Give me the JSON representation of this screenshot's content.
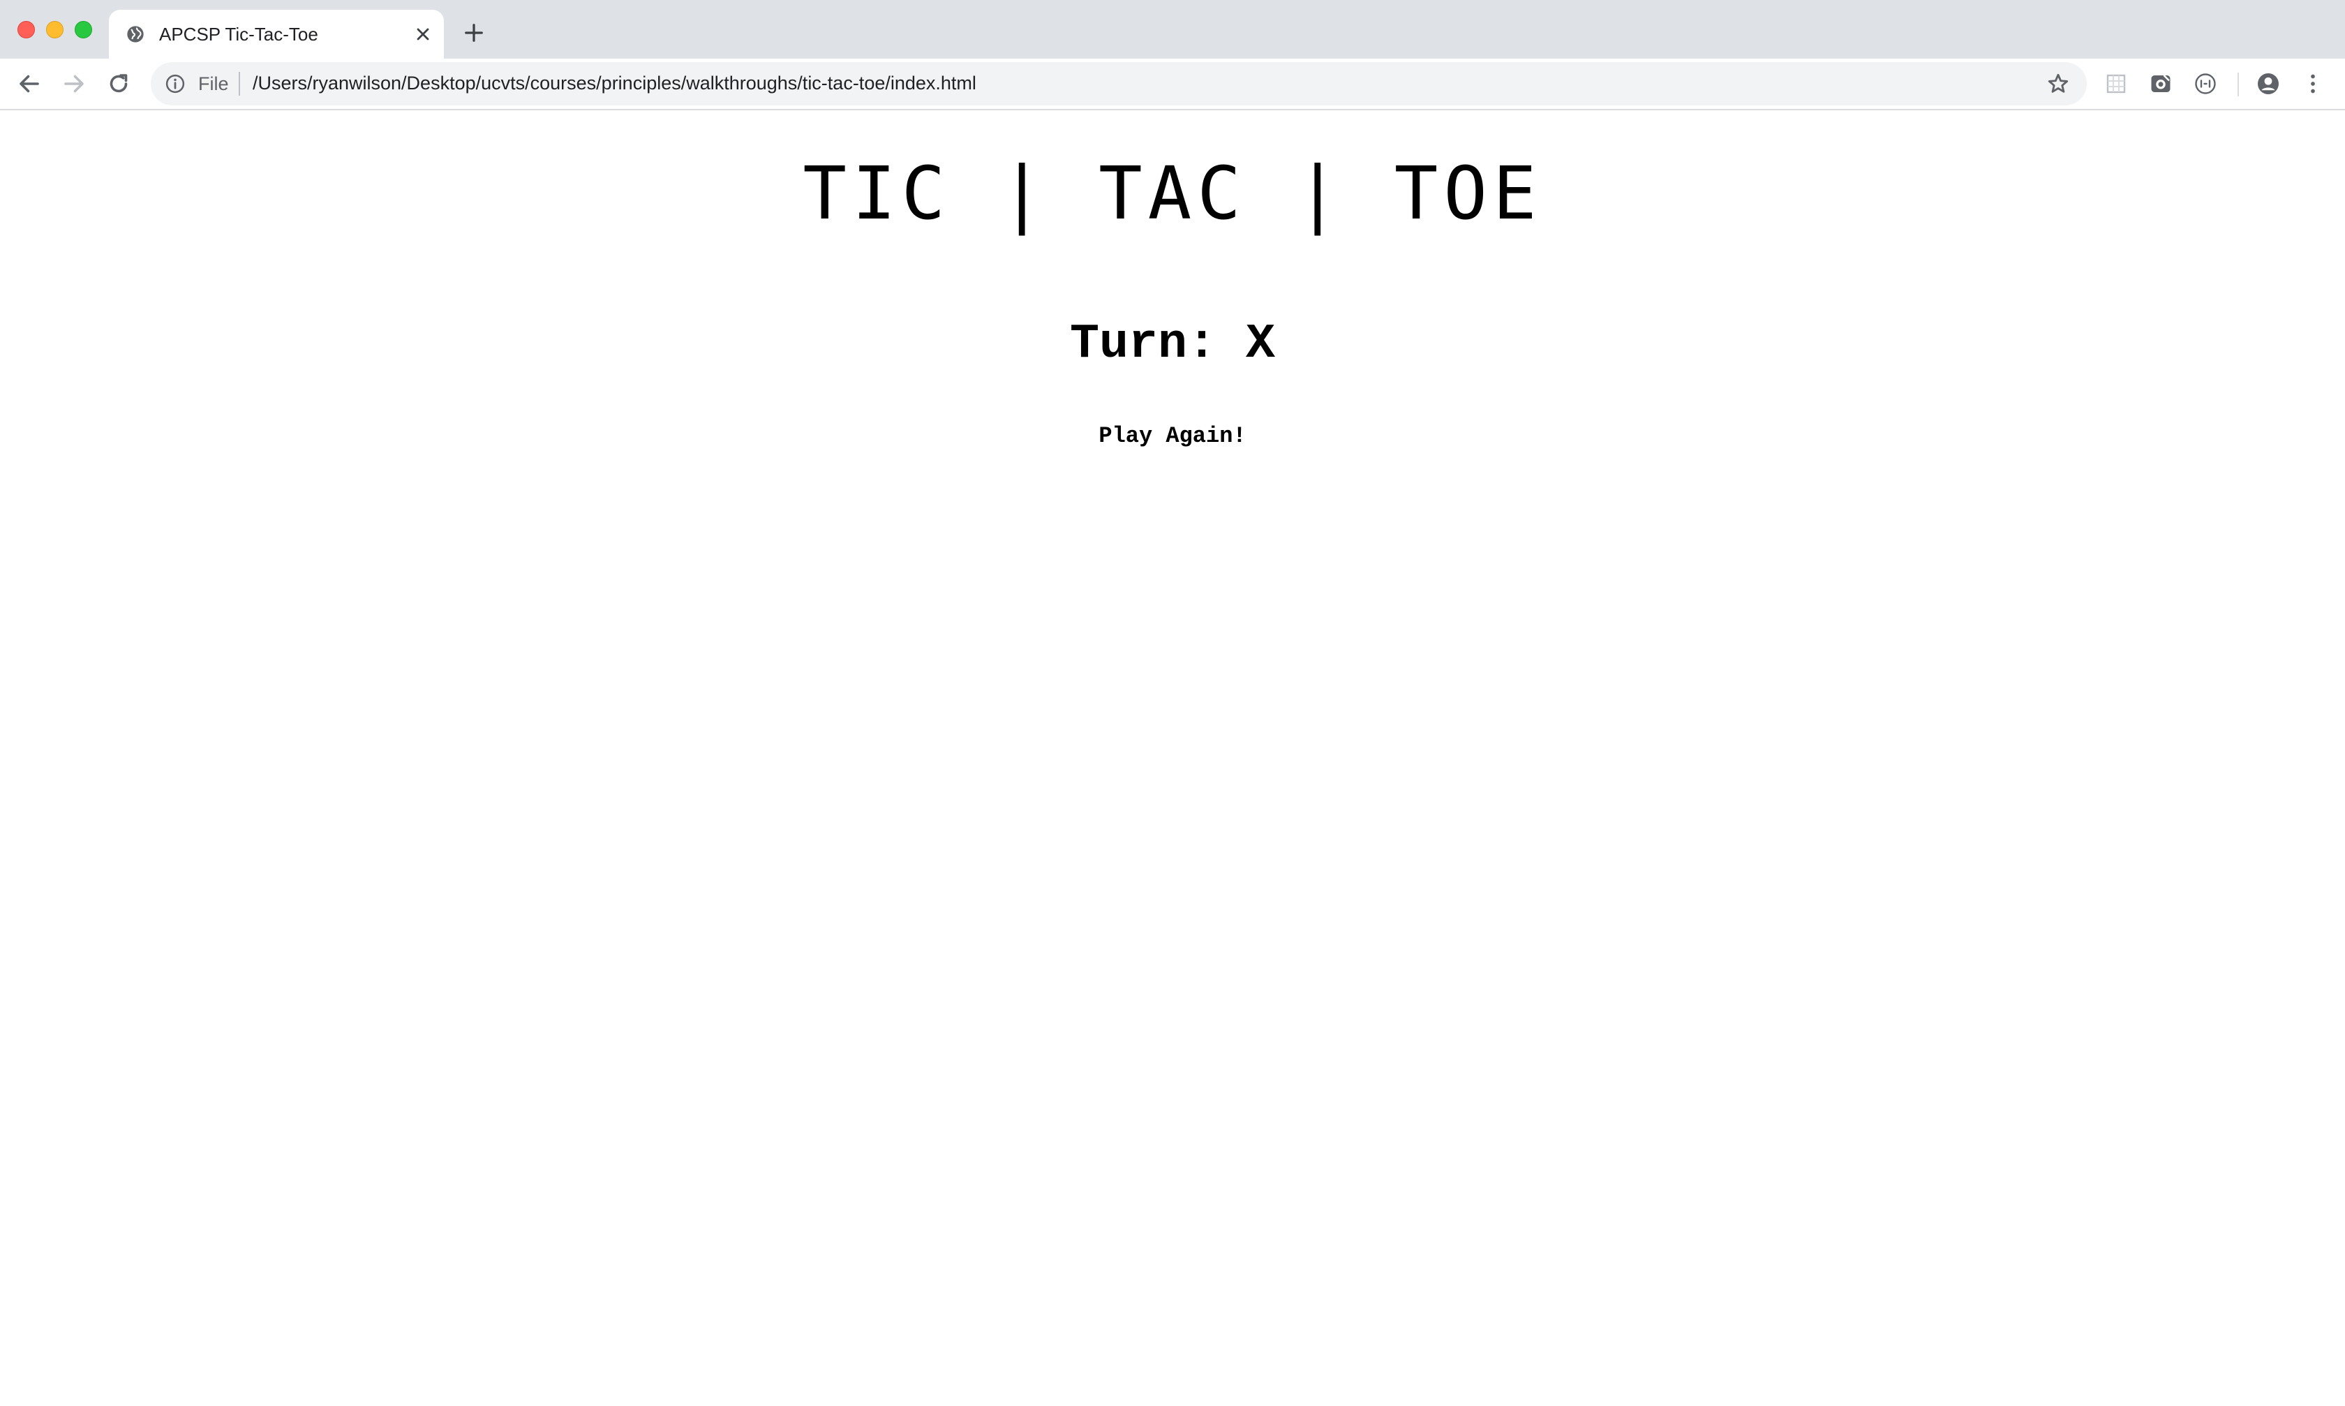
{
  "browser": {
    "tab": {
      "title": "APCSP Tic-Tac-Toe",
      "favicon": "globe-icon"
    },
    "omnibox": {
      "scheme_label": "File",
      "url": "/Users/ryanwilson/Desktop/ucvts/courses/principles/walkthroughs/tic-tac-toe/index.html"
    },
    "icons": {
      "back": "arrow-left-icon",
      "forward": "arrow-right-icon",
      "reload": "reload-icon",
      "bookmark": "star-icon",
      "profile": "account-icon",
      "menu": "kebab-menu-icon"
    },
    "colors": {
      "tabstrip": "#dee1e6",
      "omnibox": "#f1f3f4",
      "close": "#ff5f57",
      "minimize": "#febc2e",
      "maximize": "#28c840"
    }
  },
  "page": {
    "title": "TIC | TAC | TOE",
    "turn": "Turn: X",
    "play_again_label": "Play Again!"
  }
}
